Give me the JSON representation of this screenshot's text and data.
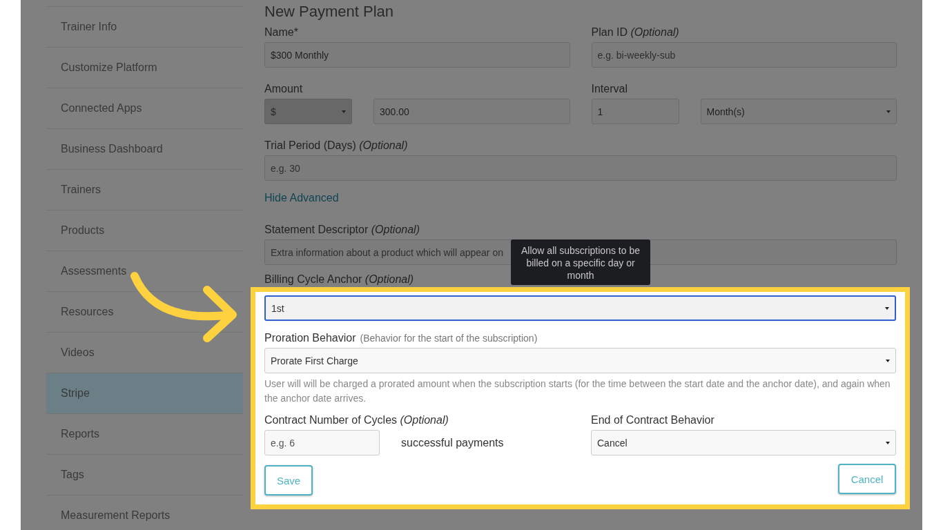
{
  "sidebar": {
    "items": [
      {
        "label": "Trainer Info",
        "selected": false
      },
      {
        "label": "Customize Platform",
        "selected": false
      },
      {
        "label": "Connected Apps",
        "selected": false
      },
      {
        "label": "Business Dashboard",
        "selected": false
      },
      {
        "label": "Trainers",
        "selected": false
      },
      {
        "label": "Products",
        "selected": false
      },
      {
        "label": "Assessments",
        "selected": false
      },
      {
        "label": "Resources",
        "selected": false
      },
      {
        "label": "Videos",
        "selected": false
      },
      {
        "label": "Stripe",
        "selected": true
      },
      {
        "label": "Reports",
        "selected": false
      },
      {
        "label": "Tags",
        "selected": false
      },
      {
        "label": "Measurement Reports",
        "selected": false
      }
    ]
  },
  "form": {
    "title": "New Payment Plan",
    "name_field": {
      "label": "Name*",
      "value": "$300 Monthly"
    },
    "plan_id_field": {
      "label": "Plan ID *(Optional)*",
      "placeholder": "e.g. bi-weekly-sub"
    },
    "amount": {
      "label": "Amount",
      "currency": {
        "value": "$",
        "disabled": true
      },
      "value": "300.00"
    },
    "interval": {
      "label": "Interval",
      "count": "1",
      "unit": "Month(s)"
    },
    "trial_field": {
      "label": "Trial Period (Days) *(Optional)*",
      "placeholder": "e.g. 30"
    },
    "advanced_link": "Hide Advanced",
    "statement_field": {
      "label": "Statement Descriptor *(Optional)*",
      "placeholder": "Extra information about a product which will appear on"
    },
    "billing_anchor": {
      "label": "Billing Cycle Anchor *(Optional)*",
      "value": "1st",
      "focused": true,
      "tooltip": "Allow all subscriptions to be billed on a specific day or month"
    },
    "proration": {
      "label": "Proration Behavior",
      "hint": "(Behavior for the start of the subscription)",
      "value": "Prorate First Charge",
      "help": "User will will be charged a prorated amount when the subscription starts (for the time between the start date and the anchor date), and again when the anchor date arrives."
    },
    "cycles": {
      "label": "Contract Number of Cycles *(Optional)*",
      "placeholder": "e.g. 6",
      "suffix": "successful payments"
    },
    "end_behavior": {
      "label": "End of Contract Behavior",
      "value": "Cancel"
    },
    "buttons": [
      {
        "label": "Save",
        "kind": "save"
      },
      {
        "label": "Cancel",
        "kind": "cancel"
      }
    ]
  }
}
